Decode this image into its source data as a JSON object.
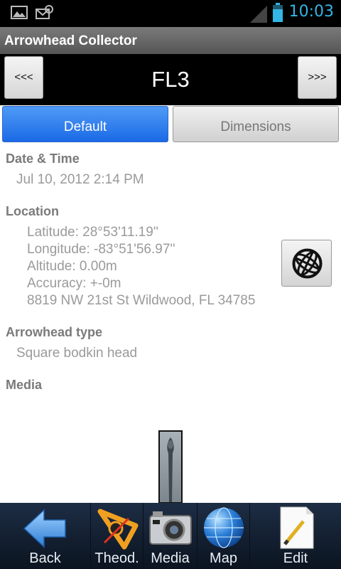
{
  "status_bar": {
    "time": "10:03",
    "icons": [
      "image-icon",
      "email-notification-icon",
      "signal-icon",
      "battery-icon"
    ]
  },
  "app": {
    "title": "Arrowhead Collector"
  },
  "record_nav": {
    "prev_label": "<<<",
    "next_label": ">>>",
    "record_name": "FL3"
  },
  "tabs": [
    {
      "label": "Default",
      "active": true
    },
    {
      "label": "Dimensions",
      "active": false
    }
  ],
  "date_time": {
    "label": "Date & Time",
    "value": "Jul 10, 2012 2:14 PM"
  },
  "location": {
    "label": "Location",
    "latitude": "Latitude: 28°53'11.19''",
    "longitude": "Longitude: -83°51'56.97''",
    "altitude": "Altitude: 0.00m",
    "accuracy": "Accuracy: +-0m",
    "address": "8819 NW 21st St Wildwood, FL 34785"
  },
  "arrowhead_type": {
    "label": "Arrowhead type",
    "value": "Square bodkin head"
  },
  "media": {
    "label": "Media"
  },
  "toolbar": {
    "back": "Back",
    "theod": "Theod.",
    "media": "Media",
    "map": "Map",
    "edit": "Edit"
  },
  "colors": {
    "accent_blue": "#33b5e5",
    "tab_active": "#1b6ae6",
    "toolbar_bg": "#0b1420"
  }
}
